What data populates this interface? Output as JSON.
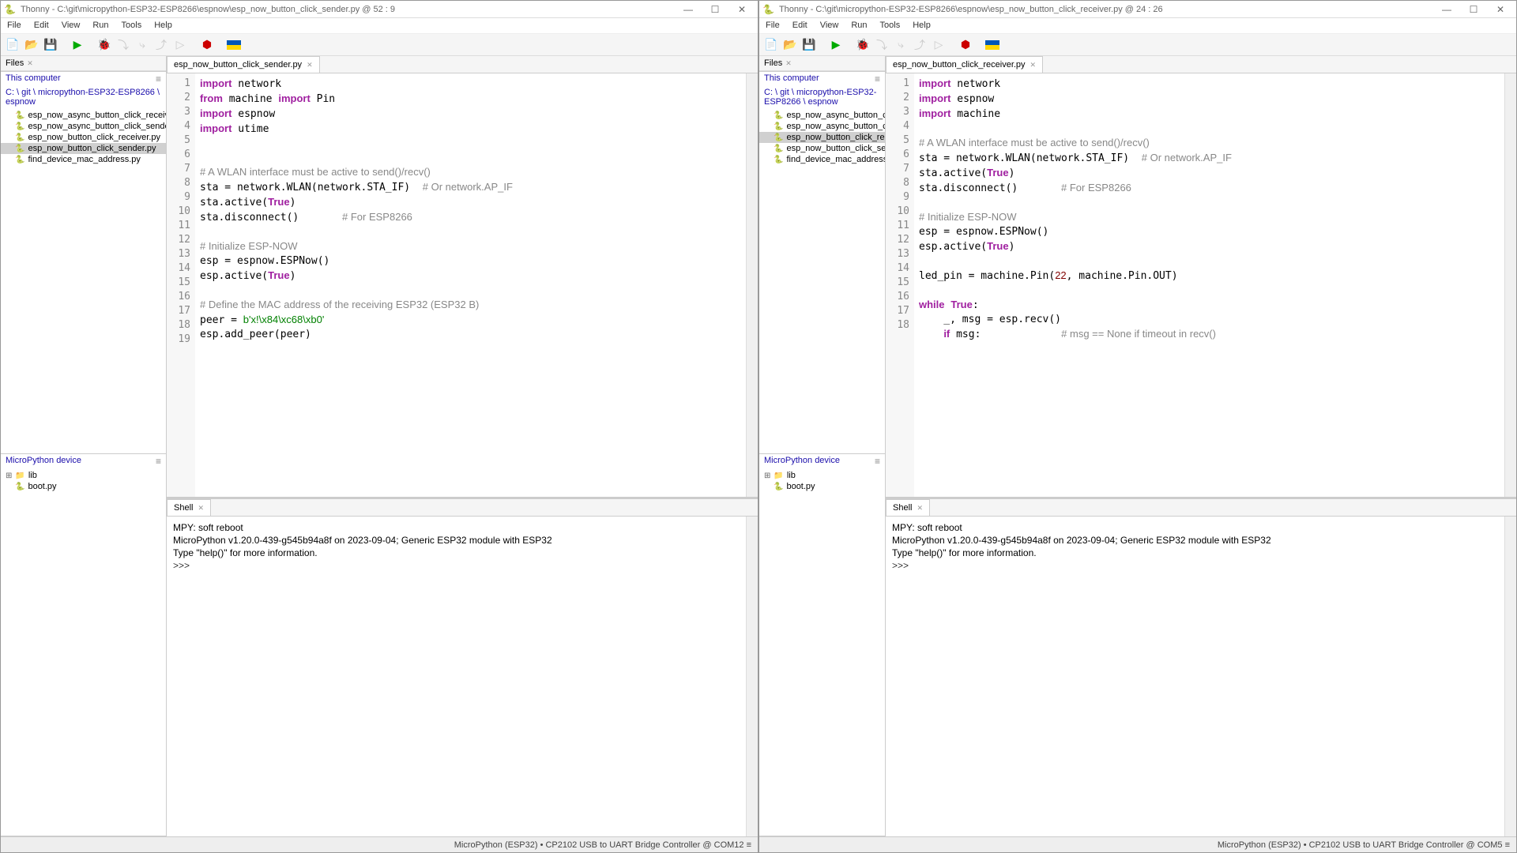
{
  "left": {
    "title": "Thonny  -  C:\\git\\micropython-ESP32-ESP8266\\espnow\\esp_now_button_click_sender.py  @  52 : 9",
    "menu": [
      "File",
      "Edit",
      "View",
      "Run",
      "Tools",
      "Help"
    ],
    "files_tab": "Files",
    "this_computer": "This computer",
    "breadcrumb": "C: \\ git \\ micropython-ESP32-ESP8266 \\ espnow",
    "files": [
      "esp_now_async_button_click_receiver.py",
      "esp_now_async_button_click_sender.py",
      "esp_now_button_click_receiver.py",
      "esp_now_button_click_sender.py",
      "find_device_mac_address.py"
    ],
    "device_tab": "MicroPython device",
    "device_files": [
      "lib",
      "boot.py"
    ],
    "editor_tab": "esp_now_button_click_sender.py",
    "code_lines": [
      {
        "n": 1,
        "html": "<span class='kw'>import</span> network"
      },
      {
        "n": 2,
        "html": "<span class='kw'>from</span> machine <span class='kw'>import</span> Pin"
      },
      {
        "n": 3,
        "html": "<span class='kw'>import</span> espnow"
      },
      {
        "n": 4,
        "html": "<span class='kw'>import</span> utime"
      },
      {
        "n": 5,
        "html": ""
      },
      {
        "n": 6,
        "html": ""
      },
      {
        "n": 7,
        "html": "<span class='cmt'># A WLAN interface must be active to send()/recv()</span>"
      },
      {
        "n": 8,
        "html": "sta = network.WLAN(network.STA_IF)  <span class='cmt'># Or network.AP_IF</span>"
      },
      {
        "n": 9,
        "html": "sta.active(<span class='kw'>True</span>)"
      },
      {
        "n": 10,
        "html": "sta.disconnect()       <span class='cmt'># For ESP8266</span>"
      },
      {
        "n": 11,
        "html": ""
      },
      {
        "n": 12,
        "html": "<span class='cmt'># Initialize ESP-NOW</span>"
      },
      {
        "n": 13,
        "html": "esp = espnow.ESPNow()"
      },
      {
        "n": 14,
        "html": "esp.active(<span class='kw'>True</span>)"
      },
      {
        "n": 15,
        "html": ""
      },
      {
        "n": 16,
        "html": "<span class='cmt'># Define the MAC address of the receiving ESP32 (ESP32 B)</span>"
      },
      {
        "n": 17,
        "html": "peer = <span class='str'>b'x!\\x84\\xc68\\xb0'</span>"
      },
      {
        "n": 18,
        "html": "esp.add_peer(peer)"
      },
      {
        "n": 19,
        "html": ""
      }
    ],
    "shell_tab": "Shell",
    "shell_text": "MPY: soft reboot\nMicroPython v1.20.0-439-g545b94a8f on 2023-09-04; Generic ESP32 module with ESP32\nType \"help()\" for more information.\n",
    "shell_prompt": ">>> ",
    "status": "MicroPython (ESP32)  •  CP2102 USB to UART Bridge Controller @ COM12  ≡"
  },
  "right": {
    "title": "Thonny  -  C:\\git\\micropython-ESP32-ESP8266\\espnow\\esp_now_button_click_receiver.py  @  24 : 26",
    "menu": [
      "File",
      "Edit",
      "View",
      "Run",
      "Tools",
      "Help"
    ],
    "files_tab": "Files",
    "this_computer": "This computer",
    "breadcrumb": "C: \\ git \\ micropython-ESP32-ESP8266 \\ espnow",
    "files": [
      "esp_now_async_button_click_re",
      "esp_now_async_button_click_se",
      "esp_now_button_click_receiver.",
      "esp_now_button_click_sender.p",
      "find_device_mac_address.py"
    ],
    "device_tab": "MicroPython device",
    "device_files": [
      "lib",
      "boot.py"
    ],
    "editor_tab": "esp_now_button_click_receiver.py",
    "code_lines": [
      {
        "n": 1,
        "html": "<span class='kw'>import</span> network"
      },
      {
        "n": 2,
        "html": "<span class='kw'>import</span> espnow"
      },
      {
        "n": 3,
        "html": "<span class='kw'>import</span> machine"
      },
      {
        "n": 4,
        "html": ""
      },
      {
        "n": 5,
        "html": "<span class='cmt'># A WLAN interface must be active to send()/recv()</span>"
      },
      {
        "n": 6,
        "html": "sta = network.WLAN(network.STA_IF)  <span class='cmt'># Or network.AP_IF</span>"
      },
      {
        "n": 7,
        "html": "sta.active(<span class='kw'>True</span>)"
      },
      {
        "n": 8,
        "html": "sta.disconnect()       <span class='cmt'># For ESP8266</span>"
      },
      {
        "n": 9,
        "html": ""
      },
      {
        "n": 10,
        "html": "<span class='cmt'># Initialize ESP-NOW</span>"
      },
      {
        "n": 11,
        "html": "esp = espnow.ESPNow()"
      },
      {
        "n": 12,
        "html": "esp.active(<span class='kw'>True</span>)"
      },
      {
        "n": 13,
        "html": ""
      },
      {
        "n": 14,
        "html": "led_pin = machine.Pin(<span class='num'>22</span>, machine.Pin.OUT)"
      },
      {
        "n": 15,
        "html": ""
      },
      {
        "n": 16,
        "html": "<span class='kw'>while</span> <span class='kw'>True</span>:"
      },
      {
        "n": 17,
        "html": "    _, msg = esp.recv()"
      },
      {
        "n": 18,
        "html": "    <span class='kw'>if</span> msg:             <span class='cmt'># msg == None if timeout in recv()</span>"
      }
    ],
    "shell_tab": "Shell",
    "shell_text": "MPY: soft reboot\nMicroPython v1.20.0-439-g545b94a8f on 2023-09-04; Generic ESP32 module with ESP32\nType \"help()\" for more information.\n",
    "shell_prompt": ">>> ",
    "status": "MicroPython (ESP32)  •  CP2102 USB to UART Bridge Controller @ COM5  ≡"
  },
  "toolbar_icons": [
    "new",
    "open",
    "save",
    "sep",
    "run",
    "sep",
    "debug",
    "step-over",
    "step-into",
    "step-out",
    "resume",
    "sep",
    "stop",
    "sep",
    "flag"
  ]
}
